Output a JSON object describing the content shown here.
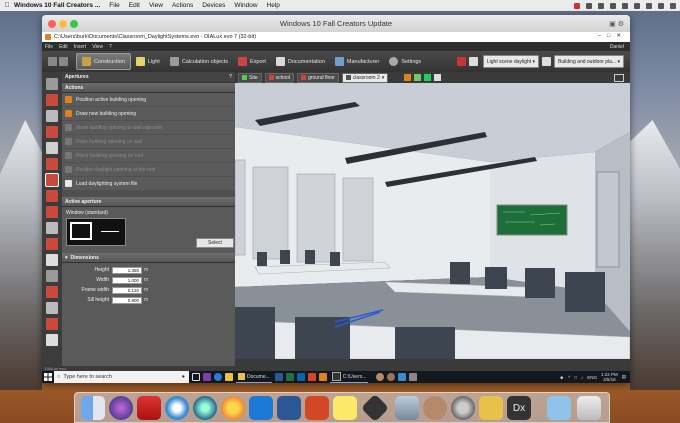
{
  "menubar": {
    "app_name": "Windows 10 Fall Creators ...",
    "items": [
      "File",
      "Edit",
      "View",
      "Actions",
      "Devices",
      "Window",
      "Help"
    ]
  },
  "mac_window": {
    "title": "Windows 10 Fall Creators Update"
  },
  "dialux": {
    "title_path": "C:\\Users\\burk\\Documents\\Classroom_DaylightSystems.evo - DIALux evo 7  (32-bit)",
    "menu": [
      "File",
      "Edit",
      "Insert",
      "View",
      "?"
    ],
    "menu_right": "Daniel",
    "toolbar_tabs": [
      {
        "label": "Construction",
        "active": true
      },
      {
        "label": "Light"
      },
      {
        "label": "Calculation objects"
      },
      {
        "label": "Export"
      },
      {
        "label": "Documentation"
      },
      {
        "label": "Manufacturer"
      },
      {
        "label": "Settings"
      }
    ],
    "scene_select": "Light scene daylight",
    "view_select": "Building and outdoor pla..."
  },
  "panel": {
    "section_title": "Apertures",
    "actions_header": "Actions",
    "actions": [
      {
        "label": "Position active building opening",
        "enabled": true
      },
      {
        "label": "Draw new building opening",
        "enabled": true
      },
      {
        "label": "Move building opening to wall opposite",
        "enabled": false
      },
      {
        "label": "Draw building opening on wall",
        "enabled": false
      },
      {
        "label": "Place building opening on roof",
        "enabled": false
      },
      {
        "label": "Position daylight opening at the roof",
        "enabled": false
      },
      {
        "label": "Load daylighting system file",
        "enabled": true
      }
    ],
    "active_aperture_header": "Active aperture",
    "window_label": "Window (standard)",
    "select_button": "Select",
    "dimensions_header": "Dimensions",
    "fields": [
      {
        "label": "Height",
        "value": "1.350",
        "unit": "m"
      },
      {
        "label": "Width",
        "value": "1.000",
        "unit": "m"
      },
      {
        "label": "Frame width",
        "value": "0.120",
        "unit": "m"
      },
      {
        "label": "Sill height",
        "value": "0.800",
        "unit": "m"
      }
    ]
  },
  "viewport": {
    "tabs": [
      {
        "label": "Site"
      },
      {
        "label": "school"
      },
      {
        "label": "ground floor"
      },
      {
        "label": "classroom 2",
        "selected": true
      }
    ]
  },
  "status": {
    "text": "DIALux evo"
  },
  "taskbar": {
    "search_placeholder": "Type here to search",
    "doc_label": "Docume...",
    "users_label": "C:\\Users...",
    "lang": "ENG",
    "time": "1:22 PM",
    "date": "3/5/18"
  },
  "dock_apps": [
    "finder",
    "siri",
    "parallels",
    "safari",
    "quicktime",
    "photos-browser",
    "windows",
    "word",
    "powerpoint",
    "notes",
    "dialux-shortcut",
    "preview",
    "contacts-photo",
    "system-preferences",
    "folder-windows",
    "dialux",
    "downloads",
    "trash"
  ],
  "colors": {
    "toolbar_bg": "#3a3a3a",
    "panel_bg": "#5a5a5a",
    "accent_orange": "#e0801e",
    "taskbar_bg": "#101820"
  }
}
